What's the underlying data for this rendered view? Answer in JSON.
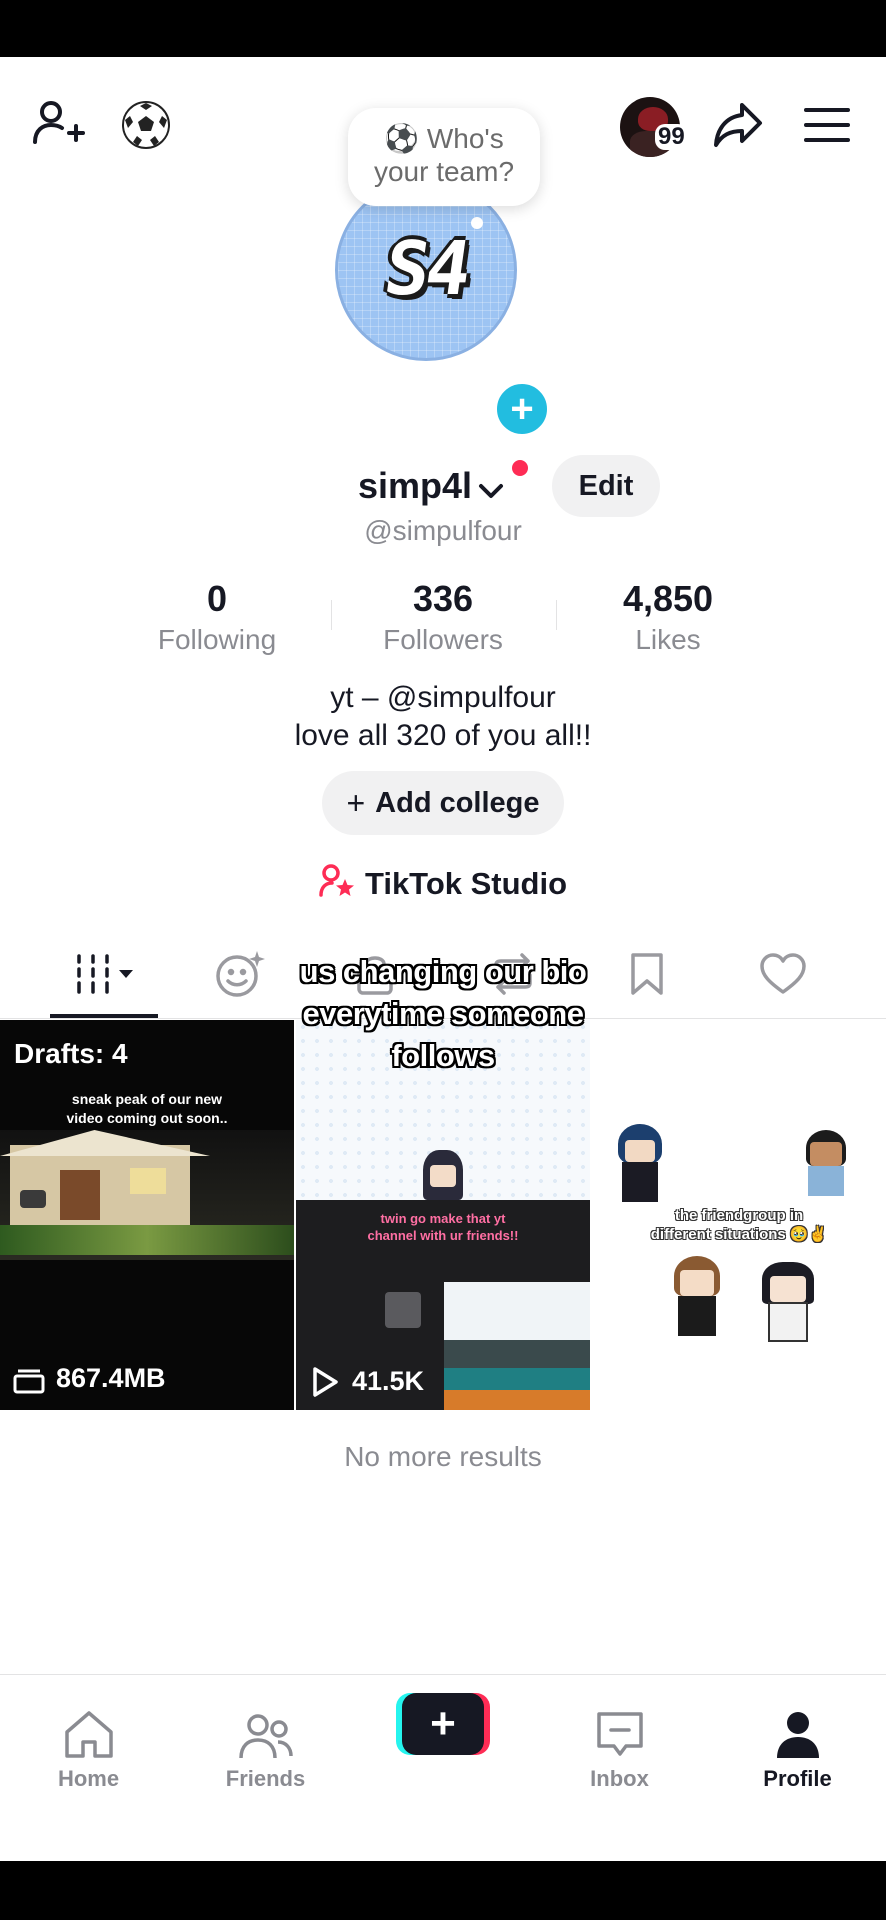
{
  "header": {
    "icons": [
      "add-friend-icon",
      "soccer-ball-icon",
      "notification-avatar-icon",
      "share-icon",
      "menu-icon"
    ],
    "notif_count": "99"
  },
  "profile": {
    "bubble_line1": "⚽ Who's",
    "bubble_line2": "your team?",
    "avatar_text": "S4",
    "username": "simp4l",
    "edit_label": "Edit",
    "handle": "@simpulfour",
    "stats": [
      {
        "value": "0",
        "label": "Following"
      },
      {
        "value": "336",
        "label": "Followers"
      },
      {
        "value": "4,850",
        "label": "Likes"
      }
    ],
    "bio_line1": "yt – @simpulfour",
    "bio_line2": "love all 320 of you all!!",
    "add_college_label": "Add college",
    "studio_label": "TikTok Studio"
  },
  "overlay_caption": {
    "line1": "us changing our bio",
    "line2": "everytime someone",
    "line3": "follows"
  },
  "grid": {
    "drafts_label": "Drafts: 4",
    "draft_caption_line1": "sneak peak of our new",
    "draft_caption_line2": "video coming out soon..",
    "draft_size": "867.4MB",
    "video2_caption_line1": "twin go make that yt",
    "video2_caption_line2": "channel with ur friends!!",
    "video2_views": "41.5K",
    "video3_caption_line1": "the friendgroup in",
    "video3_caption_line2": "different situations 🥹✌️"
  },
  "no_more_results": "No more results",
  "nav": {
    "home": "Home",
    "friends": "Friends",
    "inbox": "Inbox",
    "profile": "Profile"
  },
  "colors": {
    "accent_red": "#fe2c55",
    "accent_cyan": "#25f4ee",
    "text_dark": "#161823",
    "text_muted": "#8a8b91"
  }
}
